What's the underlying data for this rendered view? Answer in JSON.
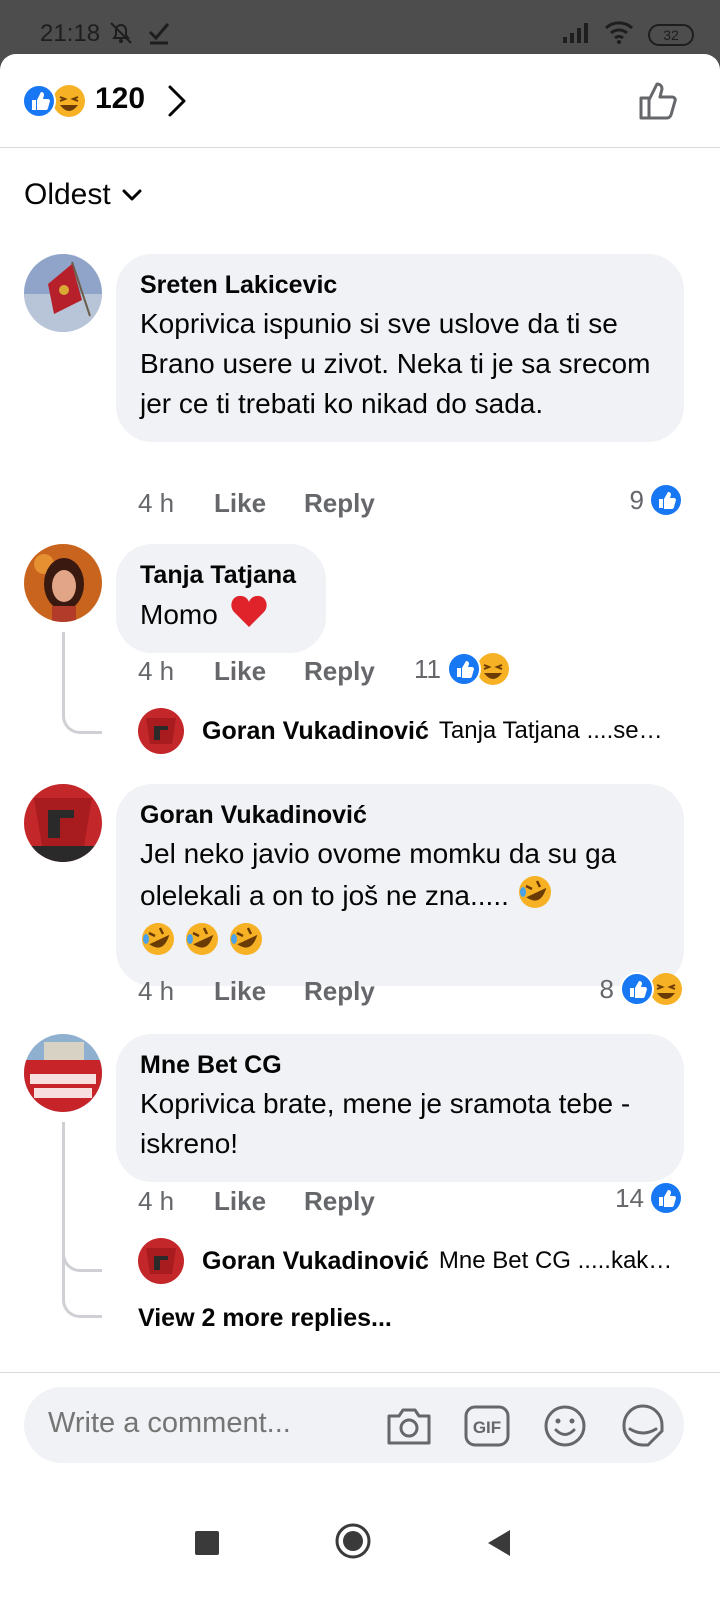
{
  "status_bar": {
    "time": "21:18",
    "battery": "32"
  },
  "header": {
    "reaction_count": "120"
  },
  "sort": {
    "label": "Oldest"
  },
  "comments": [
    {
      "author": "Sreten Lakicevic",
      "text": "Koprivica ispunio si sve uslove da ti se Brano usere u zivot. Neka ti je sa srecom jer ce ti trebati ko nikad do sada.",
      "time": "4 h",
      "like": "Like",
      "reply": "Reply",
      "reactions": "9"
    },
    {
      "author": "Tanja Tatjana",
      "text": "Momo",
      "time": "4 h",
      "like": "Like",
      "reply": "Reply",
      "reactions": "11",
      "reply_preview": {
        "author": "Goran Vukadinović",
        "snippet": "Tanja Tatjana ....se…"
      }
    },
    {
      "author": "Goran Vukadinović",
      "text": "Jel neko javio ovome momku da su ga olelekali a on to još ne zna.....",
      "time": "4 h",
      "like": "Like",
      "reply": "Reply",
      "reactions": "8"
    },
    {
      "author": "Mne Bet CG",
      "text": "Koprivica brate, mene je sramota tebe - iskreno!",
      "time": "4 h",
      "like": "Like",
      "reply": "Reply",
      "reactions": "14",
      "reply_preview": {
        "author": "Goran Vukadinović",
        "snippet": "Mne Bet CG .....kak…"
      },
      "view_more": "View 2 more replies..."
    }
  ],
  "composer": {
    "placeholder": "Write a comment..."
  },
  "colors": {
    "like_blue": "#1877f2",
    "haha_yellow": "#f7b125",
    "bubble": "#f0f2f5",
    "meta_gray": "#65676b"
  }
}
